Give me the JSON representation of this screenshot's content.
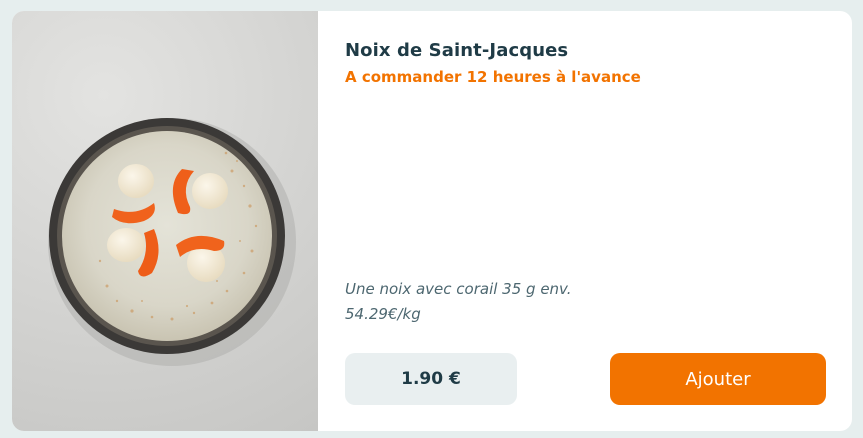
{
  "product": {
    "name": "Noix de Saint-Jacques",
    "order_notice": "A commander 12 heures à l'avance",
    "description": "Une noix avec corail 35 g env.",
    "price_per_kg": "54.29€/kg",
    "price": "1.90 €",
    "add_label": "Ajouter",
    "image_subject": "scallops-on-plate"
  },
  "colors": {
    "accent": "#f27300",
    "title": "#1f3b46",
    "price_box_bg": "#e9eff0",
    "page_bg": "#e6eeee"
  }
}
